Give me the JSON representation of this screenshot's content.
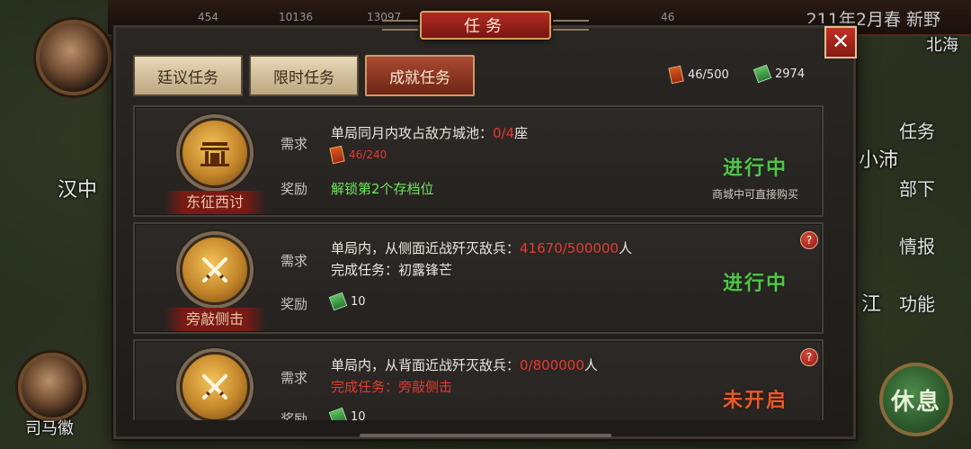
{
  "topbar": {
    "resources": [
      "454",
      "10136",
      "13097",
      "46"
    ],
    "date": "211年2月春 新野"
  },
  "map": {
    "labels": [
      "汉中",
      "小沛",
      "江",
      "北海"
    ],
    "advisor_name": "司马徽",
    "right_menu": [
      "任务",
      "部下",
      "情报",
      "功能"
    ],
    "rest_button": "休息"
  },
  "panel": {
    "title": "任务",
    "close_label": "✕",
    "tabs": [
      {
        "label": "廷议任务",
        "active": false
      },
      {
        "label": "限时任务",
        "active": false
      },
      {
        "label": "成就任务",
        "active": true
      }
    ],
    "currency": {
      "tickets": "46/500",
      "cash": "2974"
    },
    "req_label": "需求",
    "reward_label": "奖励",
    "tasks": [
      {
        "name": "东征西讨",
        "icon": "gate-icon",
        "requirement": "单局同月内攻占敌方城池：",
        "progress": "0/4",
        "unit": "座",
        "sub_progress": "46/240",
        "reward_text": "解锁第2个存档位",
        "status": "进行中",
        "note": "商城中可直接购买"
      },
      {
        "name": "旁敲侧击",
        "icon": "crossed-swords-icon",
        "requirement": "单局内，从侧面近战歼灭敌兵：",
        "progress": "41670/500000",
        "unit": "人",
        "sub_text": "完成任务：初露锋芒",
        "reward_amount": "10",
        "status": "进行中",
        "help": "?"
      },
      {
        "name": "",
        "icon": "crossed-swords-icon",
        "requirement": "单局内，从背面近战歼灭敌兵：",
        "progress": "0/800000",
        "unit": "人",
        "sub_text": "完成任务：旁敲侧击",
        "reward_amount": "10",
        "status": "未开启",
        "help": "?"
      }
    ]
  },
  "colors": {
    "accent_red": "#b02a22",
    "status_green": "#52c44a",
    "status_orange": "#e65a2a",
    "progress_red": "#e53a30",
    "reward_green": "#6ee85a"
  }
}
